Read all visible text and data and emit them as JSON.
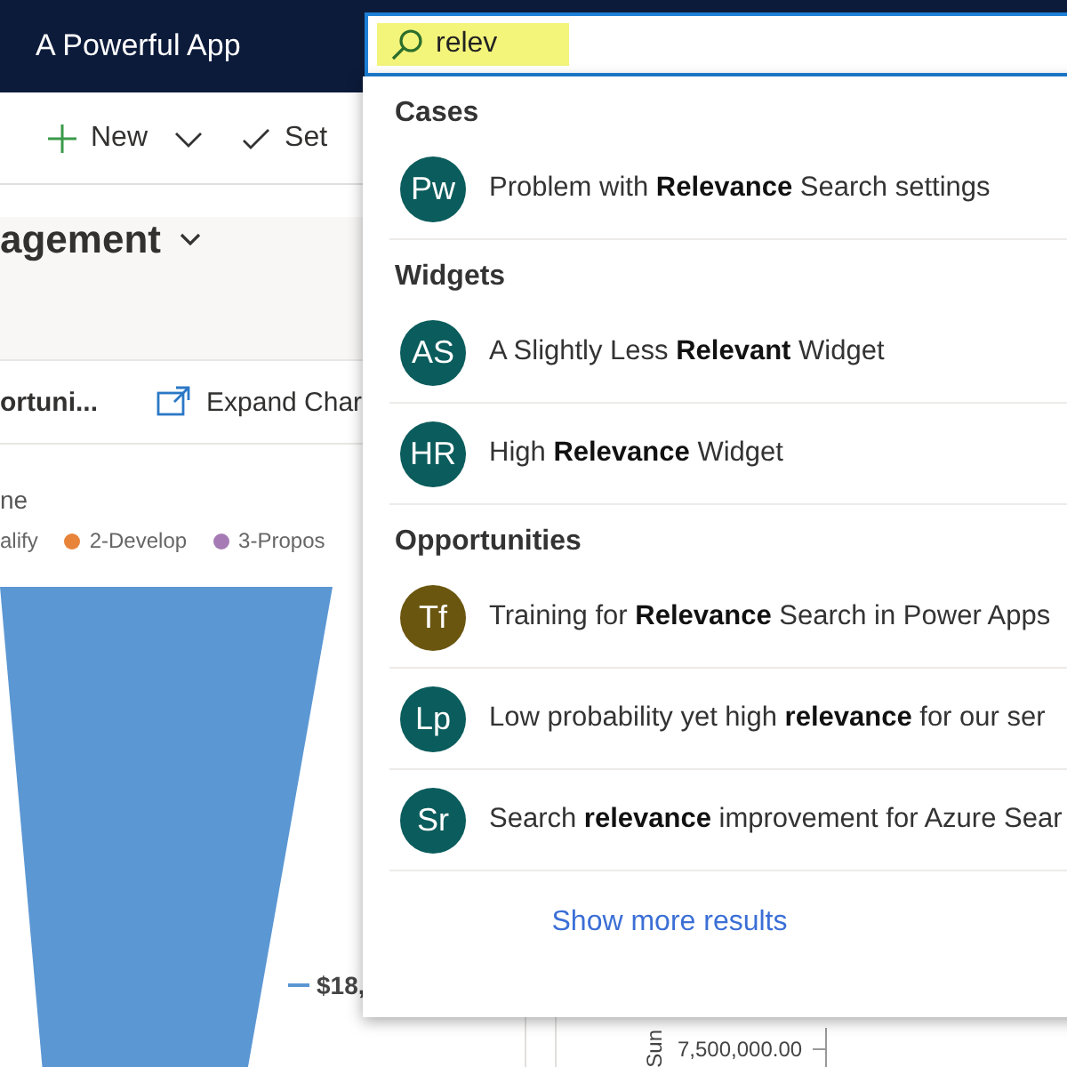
{
  "app_title": "A Powerful App",
  "search": {
    "value": "relev"
  },
  "toolbar": [
    {
      "kind": "new",
      "label": "New"
    },
    {
      "kind": "check",
      "label": "Set"
    }
  ],
  "view_title": "agement",
  "chart_bar": {
    "title": "ortuni...",
    "expand": "Expand Char"
  },
  "chart": {
    "title": "ne",
    "legend": [
      {
        "label": "alify"
      },
      {
        "label": "2-Develop",
        "color": "#e8833a"
      },
      {
        "label": "3-Propos",
        "color": "#a67bb5"
      }
    ],
    "value_label": "$18,"
  },
  "side_chart": {
    "axis_title": "Sun",
    "tick": "7,500,000.00"
  },
  "results": [
    {
      "title": "Cases",
      "items": [
        {
          "initials": "Pw",
          "color": "#0b5c5c",
          "text": "Problem with **Relevance** Search settings"
        }
      ]
    },
    {
      "title": "Widgets",
      "items": [
        {
          "initials": "AS",
          "color": "#0b5c5c",
          "text": "A Slightly Less **Relevant** Widget"
        },
        {
          "initials": "HR",
          "color": "#0b5c5c",
          "text": "High **Relevance** Widget"
        }
      ]
    },
    {
      "title": "Opportunities",
      "items": [
        {
          "initials": "Tf",
          "color": "#6b5610",
          "text": "Training for **Relevance** Search in Power Apps"
        },
        {
          "initials": "Lp",
          "color": "#0b5c5c",
          "text": "Low probability yet high **relevance** for our ser"
        },
        {
          "initials": "Sr",
          "color": "#0b5c5c",
          "text": "Search **relevance** improvement for Azure Sear"
        }
      ]
    }
  ],
  "more_link": "Show more results"
}
